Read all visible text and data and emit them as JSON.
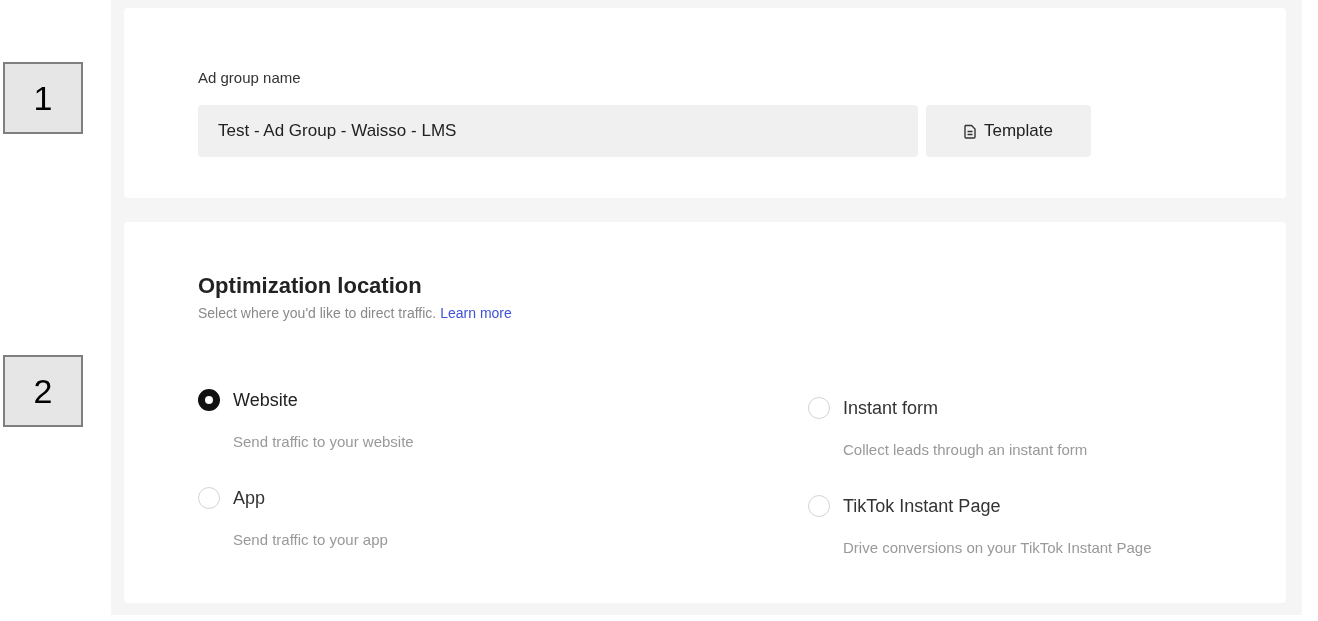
{
  "markers": [
    {
      "text": "1"
    },
    {
      "text": "2"
    }
  ],
  "ad_group": {
    "label": "Ad group name",
    "value": "Test - Ad Group - Waisso - LMS",
    "template_button": "Template"
  },
  "optimization_location": {
    "title": "Optimization location",
    "description": "Select where you'd like to direct traffic.",
    "link": "Learn more",
    "options": [
      {
        "label": "Website",
        "description": "Send traffic to your website",
        "selected": true
      },
      {
        "label": "App",
        "description": "Send traffic to your app",
        "selected": false
      },
      {
        "label": "Instant form",
        "description": "Collect leads through an instant form",
        "selected": false
      },
      {
        "label": "TikTok Instant Page",
        "description": "Drive conversions on your TikTok Instant Page",
        "selected": false
      }
    ]
  }
}
